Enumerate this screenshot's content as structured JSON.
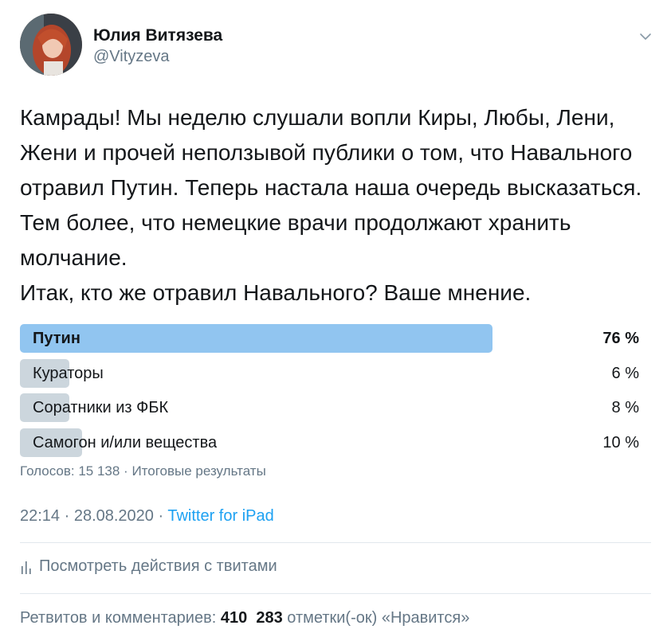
{
  "header": {
    "display_name": "Юлия Витязева",
    "handle": "@Vityzeva"
  },
  "tweet": {
    "line1": "Камрады! Мы неделю слушали вопли Киры, Любы, Лени, Жени и прочей неползывой публики о том, что Навального отравил Путин. Теперь настала наша очередь высказаться. Тем более, что немецкие врачи продолжают хранить молчание.",
    "line2": "Итак, кто же отравил Навального? Ваше мнение."
  },
  "poll": {
    "options": [
      {
        "label": "Путин",
        "percent_label": "76 %",
        "percent": 76,
        "winner": true
      },
      {
        "label": "Кураторы",
        "percent_label": "6 %",
        "percent": 6,
        "winner": false
      },
      {
        "label": "Соратники из ФБК",
        "percent_label": "8 %",
        "percent": 8,
        "winner": false
      },
      {
        "label": "Самогон и/или вещества",
        "percent_label": "10 %",
        "percent": 10,
        "winner": false
      }
    ],
    "meta": "Голосов: 15 138 · Итоговые результаты"
  },
  "timestamp": {
    "time_date": "22:14 · 28.08.2020 · ",
    "source": "Twitter for iPad"
  },
  "activity": {
    "label": "Посмотреть действия с твитами"
  },
  "stats": {
    "retweets_label": "Ретвитов и комментариев:",
    "retweets_count": "410",
    "likes_count": "283",
    "likes_label": "отметки(-ок) «Нравится»"
  },
  "colors": {
    "winner_bar": "#91c5f0",
    "bar": "#ccd6dd",
    "link": "#1da1f2",
    "secondary_text": "#657786"
  }
}
